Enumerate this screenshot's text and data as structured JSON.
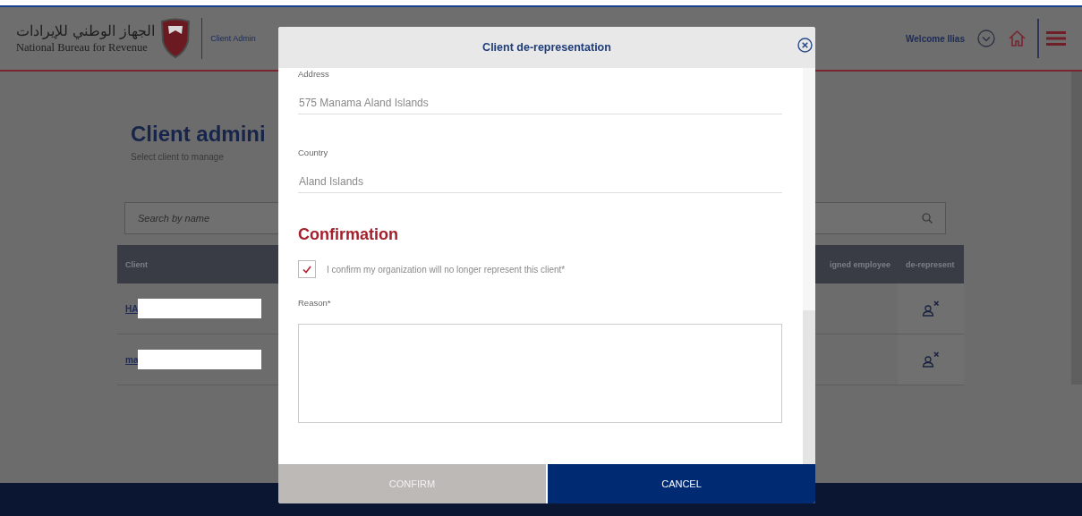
{
  "header": {
    "logo_arabic": "الجهاز الوطني للإيرادات",
    "logo_english": "National Bureau for Revenue",
    "section": "Client Admin",
    "welcome": "Welcome Ilias"
  },
  "page": {
    "title": "Client admini",
    "subtitle": "Select client to manage",
    "search": {
      "placeholder": "Search by name"
    },
    "table": {
      "columns": [
        "Client",
        "igned employee",
        "de-represent"
      ],
      "rows": [
        {
          "client": "HA",
          "redacted": true
        },
        {
          "client": "ma",
          "redacted": true
        }
      ]
    }
  },
  "modal": {
    "title": "Client de-representation",
    "fields": [
      {
        "label": "Address",
        "value": "575 Manama Aland Islands"
      },
      {
        "label": "Country",
        "value": "Aland Islands"
      }
    ],
    "section_title": "Confirmation",
    "confirm_checkbox": {
      "label": "I confirm my organization will no longer represent this client*",
      "checked": true
    },
    "reason": {
      "label": "Reason*"
    },
    "buttons": [
      {
        "label": "CONFIRM",
        "disabled": true
      },
      {
        "label": "CANCEL",
        "disabled": false
      }
    ]
  }
}
